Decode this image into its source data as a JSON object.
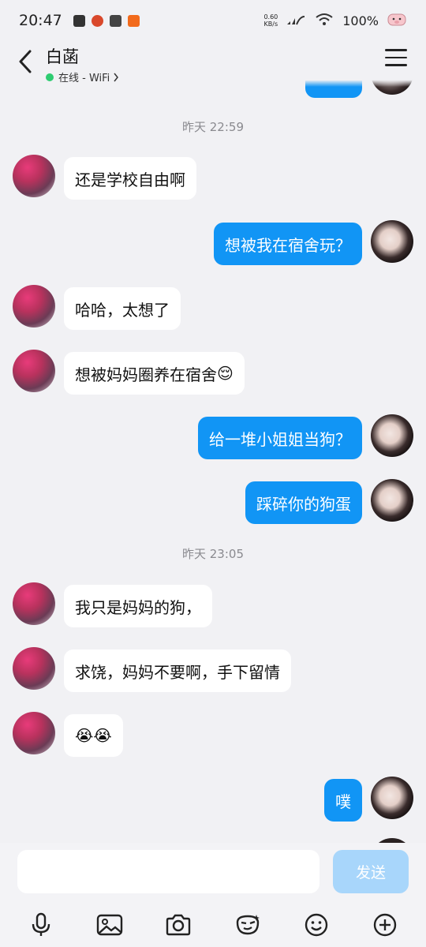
{
  "status_bar": {
    "time": "20:47",
    "net_speed_value": "0.60",
    "net_speed_unit": "KB/s",
    "battery": "100%"
  },
  "header": {
    "name": "白菡",
    "presence": "在线 - WiFi"
  },
  "timestamps": [
    "昨天 22:59",
    "昨天 23:05"
  ],
  "messages": [
    {
      "from": "them",
      "text": "还是学校自由啊"
    },
    {
      "from": "me",
      "text": "想被我在宿舍玩？"
    },
    {
      "from": "them",
      "text": "哈哈，太想了"
    },
    {
      "from": "them",
      "text": "想被妈妈圈养在宿舍",
      "emoji": "😌"
    },
    {
      "from": "me",
      "text": "给一堆小姐姐当狗？"
    },
    {
      "from": "me",
      "text": "踩碎你的狗蛋"
    },
    {
      "from": "them",
      "text": "我只是妈妈的狗，"
    },
    {
      "from": "them",
      "text": "求饶，妈妈不要啊，手下留情"
    },
    {
      "from": "them",
      "text": "😭😭"
    },
    {
      "from": "me",
      "text": "噗"
    }
  ],
  "input": {
    "placeholder": "",
    "send_label": "发送"
  },
  "toolbar_icons": [
    "microphone-icon",
    "image-icon",
    "camera-icon",
    "sticker-icon",
    "emoji-icon",
    "plus-icon"
  ],
  "colors": {
    "accent": "#1195f5",
    "send_disabled": "#a8d6fb",
    "background": "#f1f1f4",
    "online": "#2ecc71"
  }
}
